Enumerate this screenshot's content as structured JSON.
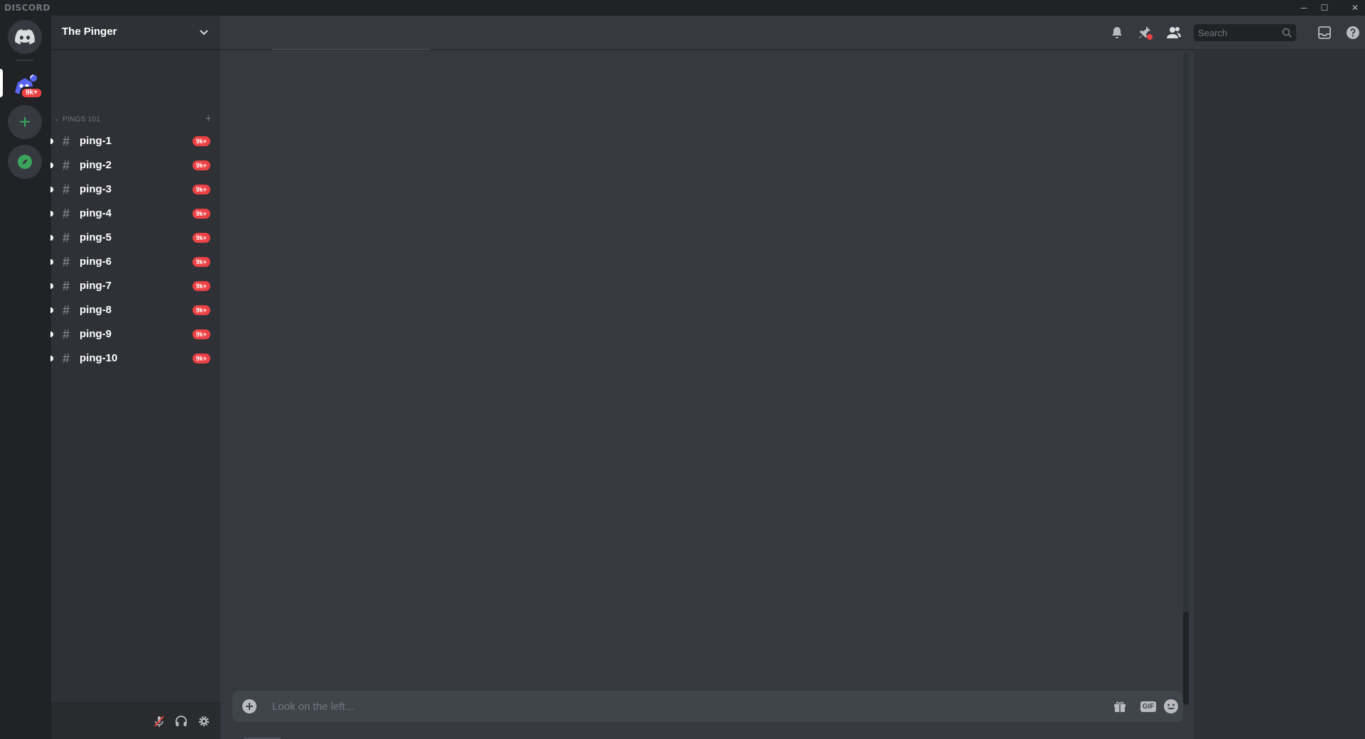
{
  "window": {
    "brand": "DISCORD",
    "controls": {
      "minimize": "─",
      "maximize": "☐",
      "close": "✕"
    }
  },
  "guilds": {
    "home_icon": "discord-logo-icon",
    "server_badge": "9k+",
    "add_icon": "+",
    "explore_icon": "compass-icon"
  },
  "server": {
    "name": "The Pinger",
    "category": "PINGS 101",
    "category_add": "+",
    "channels": [
      {
        "name": "ping-1",
        "mentions": "9k+"
      },
      {
        "name": "ping-2",
        "mentions": "9k+"
      },
      {
        "name": "ping-3",
        "mentions": "9k+"
      },
      {
        "name": "ping-4",
        "mentions": "9k+"
      },
      {
        "name": "ping-5",
        "mentions": "9k+"
      },
      {
        "name": "ping-6",
        "mentions": "9k+"
      },
      {
        "name": "ping-7",
        "mentions": "9k+"
      },
      {
        "name": "ping-8",
        "mentions": "9k+"
      },
      {
        "name": "ping-9",
        "mentions": "9k+"
      },
      {
        "name": "ping-10",
        "mentions": "9k+"
      }
    ],
    "channel_prefix": "#"
  },
  "topbar": {
    "search_placeholder": "Search",
    "icons": [
      "bell-icon",
      "pin-icon",
      "members-icon",
      "inbox-icon",
      "help-icon"
    ]
  },
  "composer": {
    "placeholder": "Look on the left...",
    "icons": [
      "add-attachment-icon",
      "gift-icon",
      "gif-icon",
      "emoji-icon"
    ],
    "gif_label": "GIF"
  },
  "user_panel": {
    "icons": [
      "mute-mic-icon",
      "headphones-icon",
      "settings-gear-icon"
    ]
  },
  "colors": {
    "mention_red": "#ed4245",
    "green": "#3ba55d",
    "blurple": "#5865f2",
    "bg_main": "#36393f",
    "bg_sidebar": "#2f3136",
    "bg_rail": "#202225"
  }
}
